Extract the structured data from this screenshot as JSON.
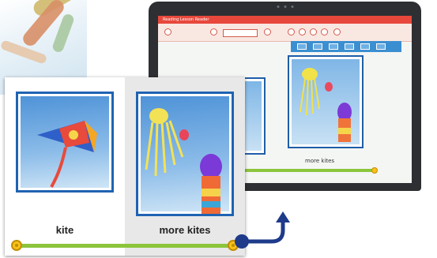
{
  "laptop_app": {
    "title": "Reading Lesson Reader",
    "caption": "more kites"
  },
  "book": {
    "left_label": "kite",
    "right_label": "more kites",
    "progress_percent": 100
  },
  "colors": {
    "accent_blue": "#1f63b3",
    "progress_green": "#8cc43c",
    "knob_yellow": "#f5c21a",
    "app_red": "#e8483c",
    "arrow_navy": "#1e3a8a"
  },
  "icons": [
    "kite-photo-icon",
    "octopus-kite-photo-icon",
    "slider-knob-icon",
    "arrow-icon"
  ]
}
